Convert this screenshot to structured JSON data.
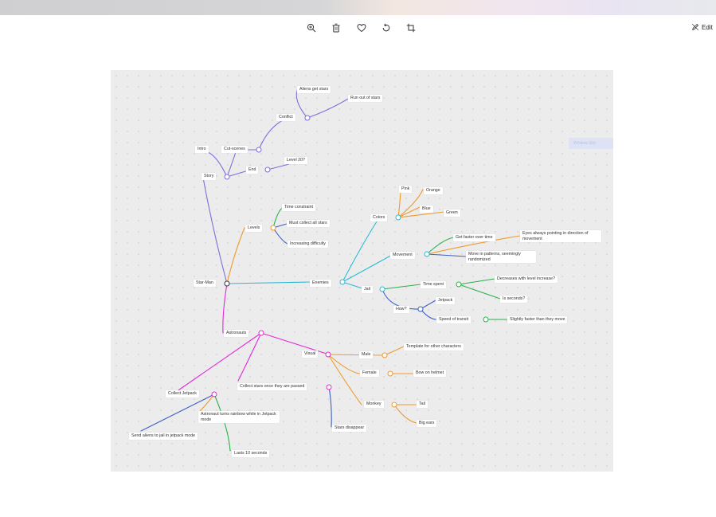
{
  "toolbar": {
    "buttons": [
      "zoom-in-icon",
      "delete-icon",
      "favorite-icon",
      "rotate-icon",
      "crop-icon"
    ],
    "edit_label": "Edit"
  },
  "mindmap": {
    "ghost_label": "Window Slot",
    "nodes": {
      "aliens_get_stars": "Aliens get stars",
      "run_out_of_stars": "Run out of stars",
      "conflict": "Conflict",
      "intro": "Intro",
      "cut_scenes": "Cut-scenes",
      "end": "End",
      "level_20": "Level 20?",
      "story": "Story",
      "time_constraint": "Time constraint",
      "must_collect": "Must collect all stars",
      "levels": "Levels",
      "increasing_difficulty": "Increasing difficulty",
      "pink": "Pink",
      "orange": "Orange",
      "blue": "Blue",
      "green": "Green",
      "colors": "Colors",
      "get_faster": "Get faster over time",
      "eyes_pointing": "Eyes always pointing in direction of movement",
      "movement": "Movement",
      "move_patterns": "Move in patterns, seemingly randomized",
      "star_man": "Star-Man",
      "enemies": "Enemies",
      "time_spent": "Time spent",
      "decreases": "Decreases with level increase?",
      "jail": "Jail",
      "seconds": "Is seconds?",
      "jetpack": "Jetpack",
      "how": "How?",
      "speed_transit": "Speed of transit",
      "slightly_faster": "Slightly faster than they move",
      "astronauts": "Astronauts",
      "visual": "Visual",
      "template": "Template for other characters",
      "male": "Male",
      "female": "Female",
      "bow": "Bow on helmet",
      "collect_stars": "Collect stars once they are passed",
      "collect_jetpack": "Collect Jetpack",
      "rainbow": "Astronaut turns rainbow while in Jetpack mode",
      "monkey": "Monkey",
      "tail": "Tail",
      "big_ears": "Big ears",
      "send_aliens": "Send aliens to jail in jetpack mode",
      "stars_disappear": "Stars disappear",
      "lasts_10": "Lasts 10 seconds"
    }
  },
  "colors": {
    "purple": "#7b6fd8",
    "orange": "#ef9a2c",
    "cyan": "#2bbad6",
    "green": "#2ab04a",
    "blue": "#3d5fc8",
    "magenta": "#e02ad8",
    "dark": "#333333"
  }
}
